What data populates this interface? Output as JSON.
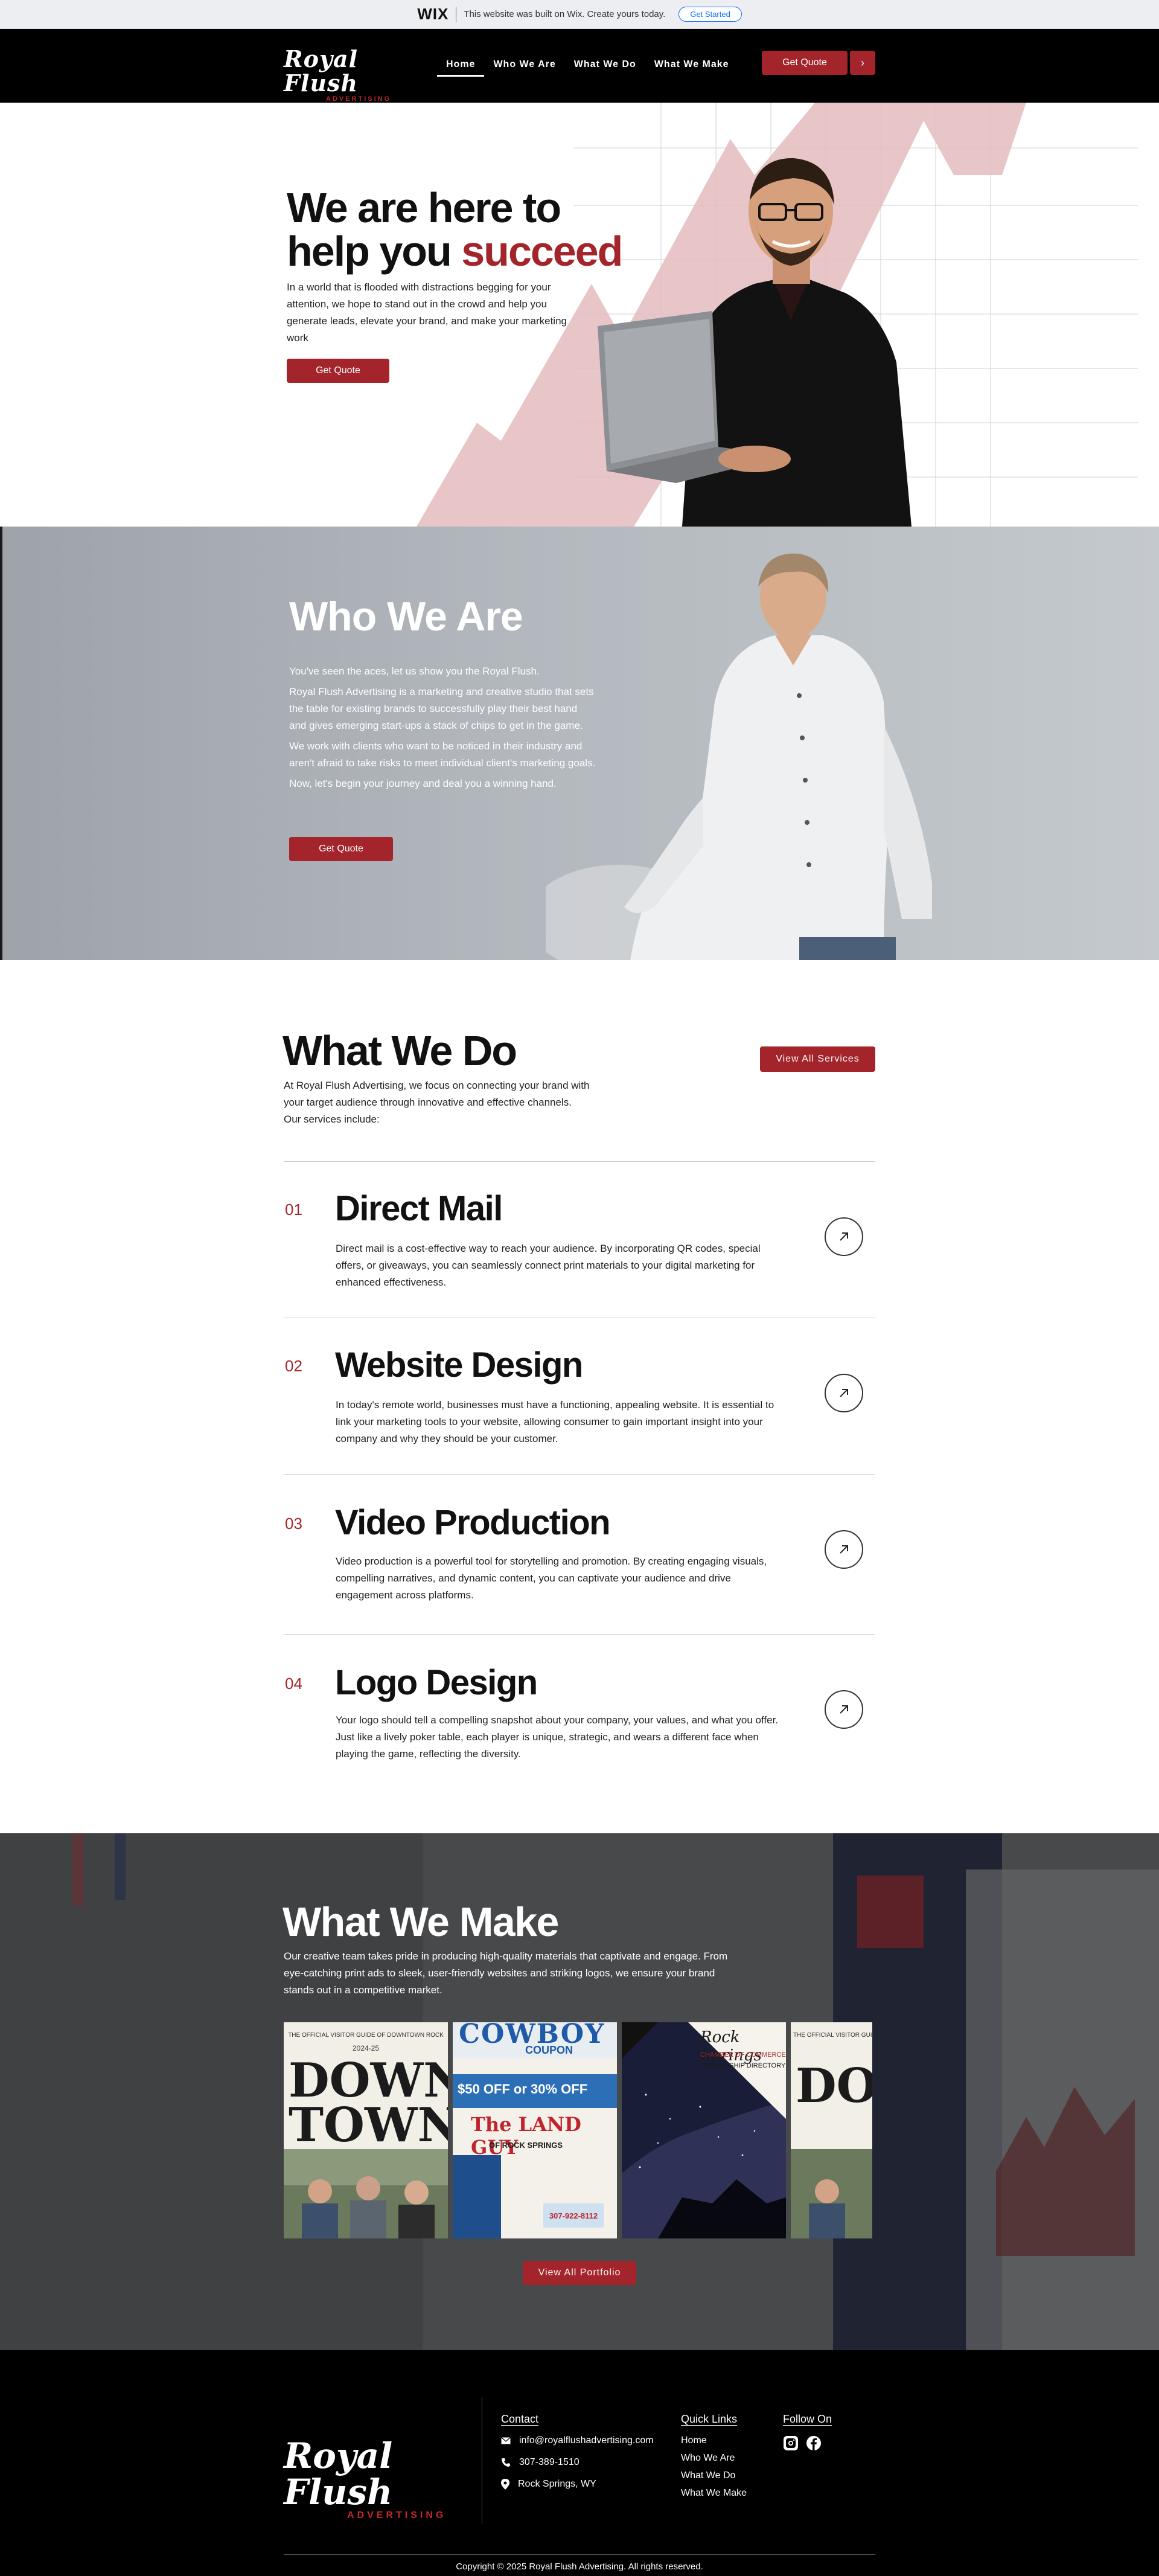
{
  "wixbar": {
    "logo": "WIX",
    "text": "This website was built on Wix. Create yours today.",
    "button": "Get Started"
  },
  "header": {
    "logo_main": "Royal Flush",
    "logo_sub": "ADVERTISING",
    "nav": [
      "Home",
      "Who We Are",
      "What We Do",
      "What We Make"
    ],
    "active_nav": "Home",
    "quote_button": "Get Quote",
    "more_button": "›"
  },
  "hero": {
    "title_line1": "We are here to",
    "title_line2a": "help you ",
    "title_line2b": "succeed",
    "description": "In a world that is flooded with distractions begging for your attention, we hope to stand out in the crowd and help you generate leads, elevate your brand, and make your marketing work",
    "button": "Get Quote",
    "accent_color": "#a3252b"
  },
  "who": {
    "title": "Who We Are",
    "paragraphs": [
      "You've seen the aces, let us show you the Royal Flush.",
      "Royal Flush Advertising is a marketing and creative studio that sets the table for existing brands to successfully play their best hand and gives emerging start-ups a stack of chips to get in the game.",
      "We work with clients who want to be noticed in their industry and aren't afraid to take risks to meet individual client's marketing goals.",
      "Now, let's begin your journey and deal you a winning hand."
    ],
    "button": "Get Quote"
  },
  "what_we_do": {
    "title": "What We Do",
    "intro": "At Royal Flush Advertising, we focus on connecting your brand with your target audience through innovative and effective channels. Our services include:",
    "view_all": "View All Services",
    "services": [
      {
        "num": "01",
        "title": "Direct Mail",
        "desc": "Direct mail is a cost-effective way to reach your audience. By incorporating QR codes, special offers, or giveaways, you can seamlessly connect print materials to your digital marketing for enhanced effectiveness."
      },
      {
        "num": "02",
        "title": "Website Design",
        "desc": "In today's remote world, businesses must have a functioning, appealing website. It is essential to link your marketing tools to your website, allowing consumer to gain important insight into your company and why they should be your customer."
      },
      {
        "num": "03",
        "title": "Video Production",
        "desc": "Video production is a powerful tool for storytelling and promotion. By creating engaging visuals, compelling narratives, and dynamic content, you can captivate your audience and drive engagement across platforms."
      },
      {
        "num": "04",
        "title": "Logo Design",
        "desc": "Your logo should tell a compelling snapshot about your company, your values, and what you offer. Just like a lively poker table, each player is unique, strategic, and wears a different face when playing the game, reflecting the diversity."
      }
    ]
  },
  "what_we_make": {
    "title": "What We Make",
    "description": "Our creative team takes pride in producing high-quality materials that captivate and engage. From eye-catching print ads to sleek, user-friendly websites and striking logos, we ensure your brand stands out in a competitive market.",
    "gallery": {
      "item1": {
        "header": "THE OFFICIAL VISITOR GUIDE OF DOWNTOWN ROCK",
        "year": "2024-25",
        "word1": "DOWN",
        "word2": "TOWN"
      },
      "item2": {
        "word": "COWBOY",
        "sub": "COUPON",
        "deal": "$50 OFF or 30% OFF",
        "brand": "The LAND GUY",
        "place": "OF ROCK SPRINGS",
        "phone": "307-922-8112"
      },
      "item3": {
        "title": "Rock Springs",
        "sub1": "CHAMBER OF COMMERCE",
        "sub2": "MEMBERSHIP DIRECTORY"
      },
      "item4": {
        "header": "THE OFFICIAL VISITOR GUI",
        "word": "DO"
      }
    },
    "button": "View All Portfolio"
  },
  "footer": {
    "logo_main": "Royal Flush",
    "logo_sub": "ADVERTISING",
    "contact_title": "Contact",
    "email": "info@royalflushadvertising.com",
    "phone": "307-389-1510",
    "location": "Rock Springs, WY",
    "links_title": "Quick Links",
    "links": [
      "Home",
      "Who We Are",
      "What We Do",
      "What We Make"
    ],
    "follow_title": "Follow On",
    "social_icons": [
      "instagram-icon",
      "facebook-icon"
    ],
    "copyright": "Copyright © 2025 Royal Flush Advertising. All rights reserved."
  }
}
